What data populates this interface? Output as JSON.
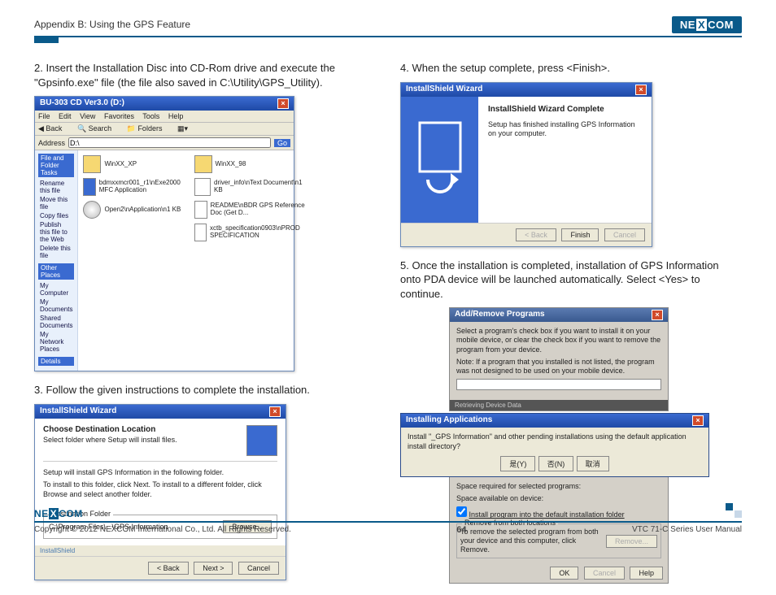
{
  "header": {
    "title": "Appendix B: Using the GPS Feature",
    "logo_text": "NEXCOM"
  },
  "footer": {
    "logo_text": "NEXCOM",
    "copyright": "Copyright © 2012 NEXCOM International Co., Ltd. All Rights Reserved.",
    "page": "64",
    "manual": "VTC 71-C Series User Manual"
  },
  "steps": {
    "s2": "2. Insert the Installation Disc into CD-Rom drive and execute the \"Gpsinfo.exe\" file (the file also saved in C:\\Utility\\GPS_Utility).",
    "s3": "3. Follow the given instructions to complete the installation.",
    "s4": "4. When the setup complete, press <Finish>.",
    "s5": "5. Once the installation is completed, installation of GPS Information onto PDA device will be launched automatically. Select <Yes> to continue."
  },
  "win2": {
    "title": "BU-303 CD Ver3.0 (D:)",
    "menu": {
      "file": "File",
      "edit": "Edit",
      "view": "View",
      "fav": "Favorites",
      "tools": "Tools",
      "help": "Help"
    },
    "nav": {
      "back": "Back",
      "search": "Search",
      "folders": "Folders"
    },
    "addr_lbl": "Address",
    "addr_val": "D:\\",
    "go": "Go",
    "side": {
      "tasks_hd": "File and Folder Tasks",
      "t1": "Rename this file",
      "t2": "Move this file",
      "t3": "Copy files",
      "t4": "Publish this file to the Web",
      "t5": "Delete this file",
      "places_hd": "Other Places",
      "p1": "My Computer",
      "p2": "My Documents",
      "p3": "Shared Documents",
      "p4": "My Network Places",
      "details_hd": "Details"
    },
    "files": {
      "f1": "WinXX_XP",
      "f2": "WinXX_98",
      "f3": "bdmxxmcr001_r1\\nExe2000 MFC Application",
      "f4": "driver_info\\nText Document\\n1 KB",
      "f5": "Open2\\nApplication\\n1 KB",
      "f6": "README\\nBDR GPS Reference Doc (Get D...",
      "f7": "",
      "f8": "xctb_specification0903\\nPROD SPECIFICATION"
    }
  },
  "win3": {
    "title": "InstallShield Wizard",
    "h": "Choose Destination Location",
    "s": "Select folder where Setup will install files.",
    "t1": "Setup will install GPS Information in the following folder.",
    "t2": "To install to this folder, click Next. To install to a different folder, click Browse and select another folder.",
    "dest_lbl": "Destination Folder",
    "dest_path": "C:\\Program Files\\...\\GPS Information",
    "browse": "Browse...",
    "back": "< Back",
    "next": "Next >",
    "cancel": "Cancel",
    "is": "InstallShield"
  },
  "win4": {
    "title": "InstallShield Wizard",
    "h": "InstallShield Wizard Complete",
    "t": "Setup has finished installing GPS Information on your computer.",
    "back": "< Back",
    "finish": "Finish",
    "cancel": "Cancel"
  },
  "win5": {
    "title": "Add/Remove Programs",
    "t1": "Select a program's check box if you want to install it on your mobile device, or clear the check box if you want to remove the program from your device.",
    "t2": "Note: If a program that you installed is not listed, the program was not designed to be used on your mobile device.",
    "darkbar": "Retrieving Device Data",
    "popup_title": "Installing Applications",
    "popup_msg": "Install \"_GPS Information\" and other pending installations using the default application install directory?",
    "yes": "是(Y)",
    "no": "否(N)",
    "cancel": "取消",
    "foot1": "Space required for selected programs:",
    "foot2": "Space available on device:",
    "chk": "Install program into the default installation folder",
    "foot3": "Remove from both locations",
    "foot4": "To remove the selected program from both your device and this computer, click Remove.",
    "remove": "Remove...",
    "ok": "OK",
    "cancel2": "Cancel",
    "help": "Help"
  }
}
